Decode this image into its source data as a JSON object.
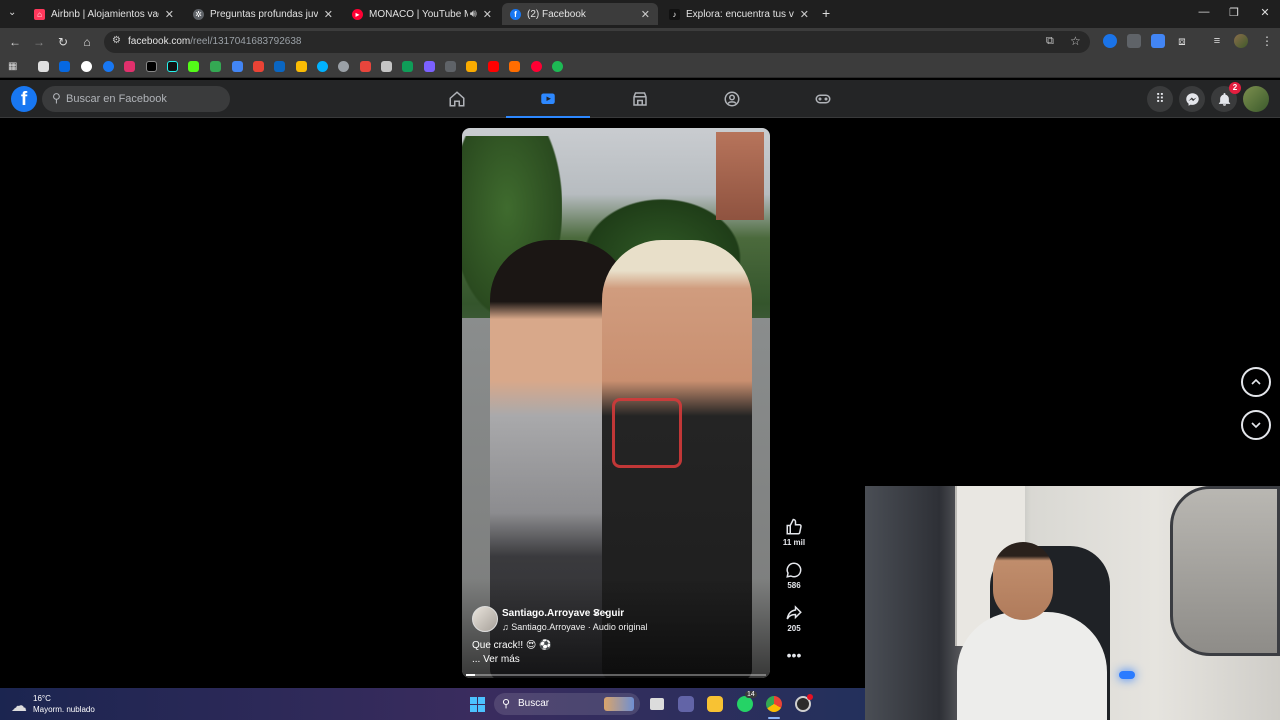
{
  "browser": {
    "tabs": [
      {
        "title": "Airbnb | Alojamientos vacacion",
        "favicon": "airbnb-icon",
        "color": "#ff385c",
        "active": false
      },
      {
        "title": "Preguntas profundas juveniles",
        "favicon": "chatgpt-icon",
        "color": "#5f6368",
        "active": false
      },
      {
        "title": "MONACO | YouTube Music",
        "favicon": "youtube-music-icon",
        "color": "#ff0033",
        "active": false
      },
      {
        "title": "(2) Facebook",
        "favicon": "facebook-icon",
        "color": "#1877f2",
        "active": true
      },
      {
        "title": "Explora: encuentra tus videos fa",
        "favicon": "tiktok-icon",
        "color": "#111111",
        "active": false
      }
    ],
    "url_host": "facebook.com",
    "url_path": "/reel/1317041683792638"
  },
  "facebook": {
    "search_placeholder": "Buscar en Facebook",
    "notifications_count": "2",
    "brand_color": "#1877f2"
  },
  "reel": {
    "author": "Santiago.Arroyave",
    "follow_label": "Seguir",
    "audio": "Santiago.Arroyave · Audio original",
    "caption": "Que crack!! 😍 ⚽",
    "see_more": "... Ver más",
    "likes": "11 mil",
    "comments": "586",
    "shares": "205",
    "progress": 0.03
  },
  "taskbar": {
    "temperature": "16°C",
    "condition": "Mayorm. nublado",
    "search_label": "Buscar",
    "whatsapp_badge": "14"
  }
}
